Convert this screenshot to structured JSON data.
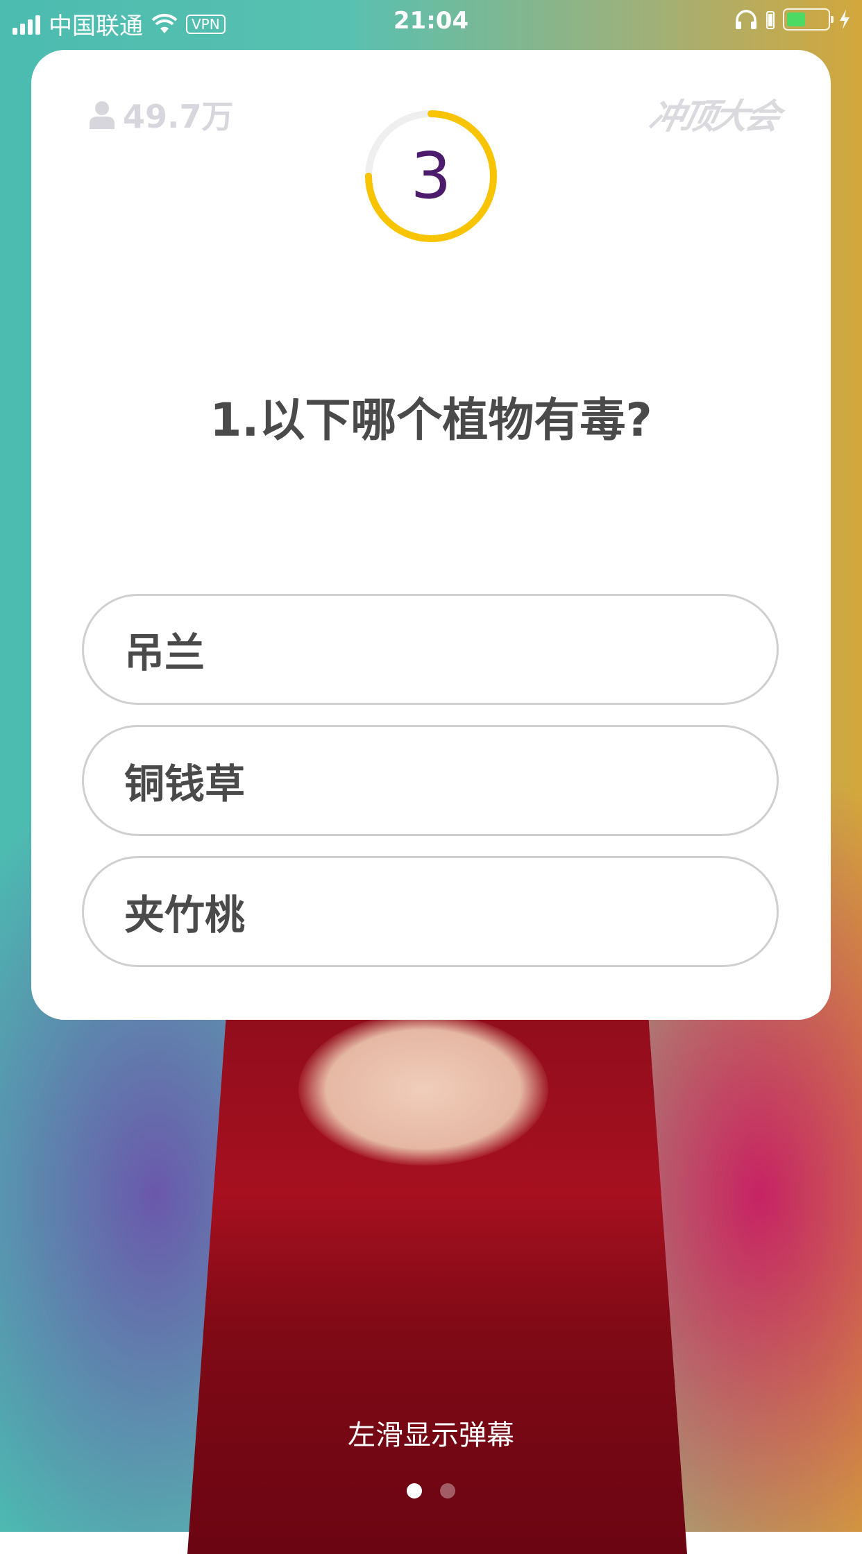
{
  "status_bar": {
    "carrier": "中国联通",
    "vpn": "VPN",
    "time": "21:04"
  },
  "card": {
    "viewer_count": "49.7万",
    "brand": "冲顶大会",
    "countdown": "3",
    "countdown_progress": 0.75,
    "question": "1.以下哪个植物有毒?",
    "options": [
      "吊兰",
      "铜钱草",
      "夹竹桃"
    ]
  },
  "hint": "左滑显示弹幕",
  "pager": {
    "pages": 2,
    "active": 0
  },
  "colors": {
    "timer_ring": "#f8c400",
    "timer_track": "#efefef",
    "countdown_text": "#4d1b6b",
    "battery": "#4cd964"
  }
}
